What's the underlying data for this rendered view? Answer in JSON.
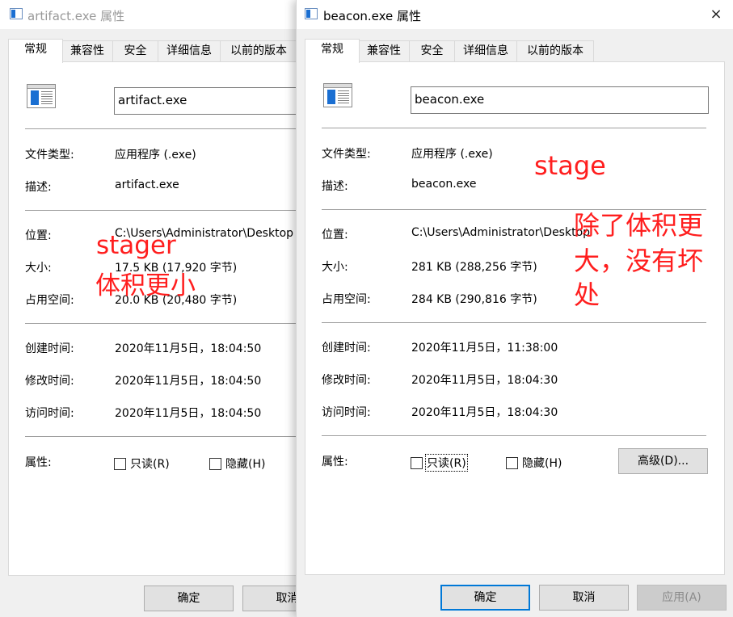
{
  "left_window": {
    "title": "artifact.exe 属性",
    "tabs": [
      "常规",
      "兼容性",
      "安全",
      "详细信息",
      "以前的版本"
    ],
    "file_name": "artifact.exe",
    "rows": [
      {
        "label": "文件类型:",
        "value": "应用程序 (.exe)"
      },
      {
        "label": "描述:",
        "value": "artifact.exe"
      },
      {
        "label": "位置:",
        "value": "C:\\Users\\Administrator\\Desktop"
      },
      {
        "label": "大小:",
        "value": "17.5 KB (17,920 字节)"
      },
      {
        "label": "占用空间:",
        "value": "20.0 KB (20,480 字节)"
      },
      {
        "label": "创建时间:",
        "value": "2020年11月5日，18:04:50"
      },
      {
        "label": "修改时间:",
        "value": "2020年11月5日，18:04:50"
      },
      {
        "label": "访问时间:",
        "value": "2020年11月5日，18:04:50"
      }
    ],
    "attributes_label": "属性:",
    "readonly_label": "只读(R)",
    "hidden_label": "隐藏(H)",
    "ok_label": "确定",
    "cancel_label": "取消"
  },
  "right_window": {
    "title": "beacon.exe 属性",
    "close_icon": "×",
    "tabs": [
      "常规",
      "兼容性",
      "安全",
      "详细信息",
      "以前的版本"
    ],
    "file_name": "beacon.exe",
    "rows": [
      {
        "label": "文件类型:",
        "value": "应用程序 (.exe)"
      },
      {
        "label": "描述:",
        "value": "beacon.exe"
      },
      {
        "label": "位置:",
        "value": "C:\\Users\\Administrator\\Desktop"
      },
      {
        "label": "大小:",
        "value": "281 KB (288,256 字节)"
      },
      {
        "label": "占用空间:",
        "value": "284 KB (290,816 字节)"
      },
      {
        "label": "创建时间:",
        "value": "2020年11月5日，11:38:00"
      },
      {
        "label": "修改时间:",
        "value": "2020年11月5日，18:04:30"
      },
      {
        "label": "访问时间:",
        "value": "2020年11月5日，18:04:30"
      }
    ],
    "attributes_label": "属性:",
    "readonly_label": "只读(R)",
    "hidden_label": "隐藏(H)",
    "advanced_label": "高级(D)...",
    "ok_label": "确定",
    "cancel_label": "取消",
    "apply_label": "应用(A)"
  },
  "annotations": {
    "stager": "stager",
    "stager_note": "体积更小",
    "stage": "stage",
    "stage_note_1": "除了体积更",
    "stage_note_2": "大，没有坏",
    "stage_note_3": "处"
  },
  "colors": {
    "annotation": "#ff1e1e",
    "accent": "#0078d7",
    "file_icon": "#1a6fd2"
  }
}
